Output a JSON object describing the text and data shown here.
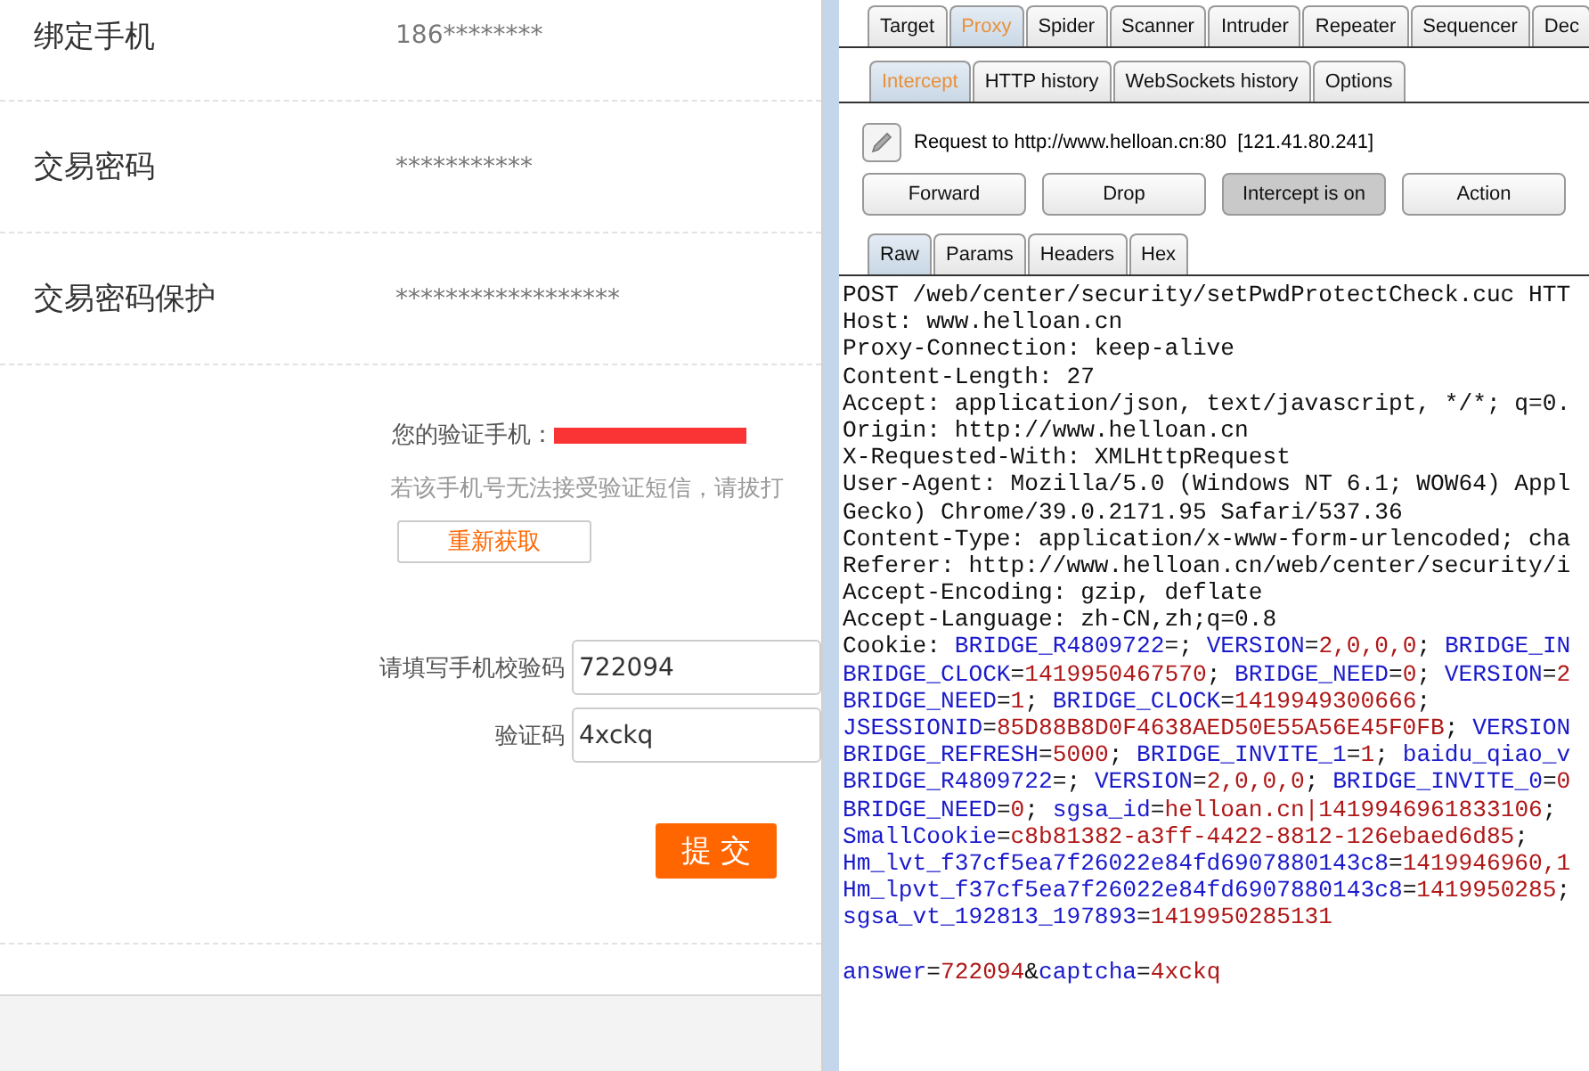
{
  "account_rows": [
    {
      "label": "绑定手机",
      "value": "186********"
    },
    {
      "label": "交易密码",
      "value": "***********"
    },
    {
      "label": "交易密码保护",
      "value": "******************"
    }
  ],
  "verification": {
    "phone_label": "您的验证手机：",
    "hint": "若该手机号无法接受验证短信，请拔打",
    "resend_button": "重新获取",
    "fields": [
      {
        "label": "请填写手机校验码",
        "value": "722094"
      },
      {
        "label": "验证码",
        "value": "4xckq"
      }
    ],
    "submit_button": "提 交"
  },
  "proxy_tool": {
    "main_tabs": [
      {
        "label": "Target",
        "selected": false
      },
      {
        "label": "Proxy",
        "selected": true
      },
      {
        "label": "Spider",
        "selected": false
      },
      {
        "label": "Scanner",
        "selected": false
      },
      {
        "label": "Intruder",
        "selected": false
      },
      {
        "label": "Repeater",
        "selected": false
      },
      {
        "label": "Sequencer",
        "selected": false
      },
      {
        "label": "Dec",
        "selected": false
      }
    ],
    "sub_tabs": [
      {
        "label": "Intercept",
        "selected": true
      },
      {
        "label": "HTTP history",
        "selected": false
      },
      {
        "label": "WebSockets history",
        "selected": false
      },
      {
        "label": "Options",
        "selected": false
      }
    ],
    "request_info": "Request to http://www.helloan.cn:80  [121.41.80.241]",
    "buttons": [
      {
        "label": "Forward",
        "pressed": false
      },
      {
        "label": "Drop",
        "pressed": false
      },
      {
        "label": "Intercept is on",
        "pressed": true
      },
      {
        "label": "Action",
        "pressed": false
      }
    ],
    "view_tabs": [
      {
        "label": "Raw",
        "selected": true
      },
      {
        "label": "Params",
        "selected": false
      },
      {
        "label": "Headers",
        "selected": false
      },
      {
        "label": "Hex",
        "selected": false
      }
    ],
    "request_lines": [
      [
        {
          "text": "POST /web/center/security/setPwdProtectCheck.cuc HTT",
          "kind": "plain"
        }
      ],
      [
        {
          "text": "Host: www.helloan.cn",
          "kind": "plain"
        }
      ],
      [
        {
          "text": "Proxy-Connection: keep-alive",
          "kind": "plain"
        }
      ],
      [
        {
          "text": "Content-Length: 27",
          "kind": "plain"
        }
      ],
      [
        {
          "text": "Accept: application/json, text/javascript, */*; q=0.",
          "kind": "plain"
        }
      ],
      [
        {
          "text": "Origin: http://www.helloan.cn",
          "kind": "plain"
        }
      ],
      [
        {
          "text": "X-Requested-With: XMLHttpRequest",
          "kind": "plain"
        }
      ],
      [
        {
          "text": "User-Agent: Mozilla/5.0 (Windows NT 6.1; WOW64) Appl",
          "kind": "plain"
        }
      ],
      [
        {
          "text": "Gecko) Chrome/39.0.2171.95 Safari/537.36",
          "kind": "plain"
        }
      ],
      [
        {
          "text": "Content-Type: application/x-www-form-urlencoded; cha",
          "kind": "plain"
        }
      ],
      [
        {
          "text": "Referer: http://www.helloan.cn/web/center/security/i",
          "kind": "plain"
        }
      ],
      [
        {
          "text": "Accept-Encoding: gzip, deflate",
          "kind": "plain"
        }
      ],
      [
        {
          "text": "Accept-Language: zh-CN,zh;q=0.8",
          "kind": "plain"
        }
      ],
      [
        {
          "text": "Cookie: ",
          "kind": "plain"
        },
        {
          "text": "BRIDGE_R4809722",
          "kind": "name"
        },
        {
          "text": "=; ",
          "kind": "plain"
        },
        {
          "text": "VERSION",
          "kind": "name"
        },
        {
          "text": "=",
          "kind": "plain"
        },
        {
          "text": "2,0,0,0",
          "kind": "value"
        },
        {
          "text": "; ",
          "kind": "plain"
        },
        {
          "text": "BRIDGE_IN",
          "kind": "name"
        }
      ],
      [
        {
          "text": "BRIDGE_CLOCK",
          "kind": "name"
        },
        {
          "text": "=",
          "kind": "plain"
        },
        {
          "text": "1419950467570",
          "kind": "value"
        },
        {
          "text": "; ",
          "kind": "plain"
        },
        {
          "text": "BRIDGE_NEED",
          "kind": "name"
        },
        {
          "text": "=",
          "kind": "plain"
        },
        {
          "text": "0",
          "kind": "value"
        },
        {
          "text": "; ",
          "kind": "plain"
        },
        {
          "text": "VERSION",
          "kind": "name"
        },
        {
          "text": "=",
          "kind": "plain"
        },
        {
          "text": "2",
          "kind": "value"
        }
      ],
      [
        {
          "text": "BRIDGE_NEED",
          "kind": "name"
        },
        {
          "text": "=",
          "kind": "plain"
        },
        {
          "text": "1",
          "kind": "value"
        },
        {
          "text": "; ",
          "kind": "plain"
        },
        {
          "text": "BRIDGE_CLOCK",
          "kind": "name"
        },
        {
          "text": "=",
          "kind": "plain"
        },
        {
          "text": "1419949300666",
          "kind": "value"
        },
        {
          "text": ";",
          "kind": "plain"
        }
      ],
      [
        {
          "text": "JSESSIONID",
          "kind": "name"
        },
        {
          "text": "=",
          "kind": "plain"
        },
        {
          "text": "85D88B8D0F4638AED50E55A56E45F0FB",
          "kind": "value"
        },
        {
          "text": "; ",
          "kind": "plain"
        },
        {
          "text": "VERSION",
          "kind": "name"
        }
      ],
      [
        {
          "text": "BRIDGE_REFRESH",
          "kind": "name"
        },
        {
          "text": "=",
          "kind": "plain"
        },
        {
          "text": "5000",
          "kind": "value"
        },
        {
          "text": "; ",
          "kind": "plain"
        },
        {
          "text": "BRIDGE_INVITE_1",
          "kind": "name"
        },
        {
          "text": "=",
          "kind": "plain"
        },
        {
          "text": "1",
          "kind": "value"
        },
        {
          "text": "; ",
          "kind": "plain"
        },
        {
          "text": "baidu_qiao_v",
          "kind": "name"
        }
      ],
      [
        {
          "text": "BRIDGE_R4809722",
          "kind": "name"
        },
        {
          "text": "=; ",
          "kind": "plain"
        },
        {
          "text": "VERSION",
          "kind": "name"
        },
        {
          "text": "=",
          "kind": "plain"
        },
        {
          "text": "2,0,0,0",
          "kind": "value"
        },
        {
          "text": "; ",
          "kind": "plain"
        },
        {
          "text": "BRIDGE_INVITE_0",
          "kind": "name"
        },
        {
          "text": "=",
          "kind": "plain"
        },
        {
          "text": "0",
          "kind": "value"
        }
      ],
      [
        {
          "text": "BRIDGE_NEED",
          "kind": "name"
        },
        {
          "text": "=",
          "kind": "plain"
        },
        {
          "text": "0",
          "kind": "value"
        },
        {
          "text": "; ",
          "kind": "plain"
        },
        {
          "text": "sgsa_id",
          "kind": "name"
        },
        {
          "text": "=",
          "kind": "plain"
        },
        {
          "text": "helloan.cn|1419946961833106",
          "kind": "value"
        },
        {
          "text": ";",
          "kind": "plain"
        }
      ],
      [
        {
          "text": "SmallCookie",
          "kind": "name"
        },
        {
          "text": "=",
          "kind": "plain"
        },
        {
          "text": "c8b81382-a3ff-4422-8812-126ebaed6d85",
          "kind": "value"
        },
        {
          "text": ";",
          "kind": "plain"
        }
      ],
      [
        {
          "text": "Hm_lvt_f37cf5ea7f26022e84fd6907880143c8",
          "kind": "name"
        },
        {
          "text": "=",
          "kind": "plain"
        },
        {
          "text": "1419946960,1",
          "kind": "value"
        }
      ],
      [
        {
          "text": "Hm_lpvt_f37cf5ea7f26022e84fd6907880143c8",
          "kind": "name"
        },
        {
          "text": "=",
          "kind": "plain"
        },
        {
          "text": "1419950285",
          "kind": "value"
        },
        {
          "text": ";",
          "kind": "plain"
        }
      ],
      [
        {
          "text": "sgsa_vt_192813_197893",
          "kind": "name"
        },
        {
          "text": "=",
          "kind": "plain"
        },
        {
          "text": "1419950285131",
          "kind": "value"
        }
      ]
    ],
    "request_body": [
      {
        "text": "answer",
        "kind": "name"
      },
      {
        "text": "=",
        "kind": "plain"
      },
      {
        "text": "722094",
        "kind": "value"
      },
      {
        "text": "&",
        "kind": "plain"
      },
      {
        "text": "captcha",
        "kind": "name"
      },
      {
        "text": "=",
        "kind": "plain"
      },
      {
        "text": "4xckq",
        "kind": "value"
      }
    ]
  }
}
